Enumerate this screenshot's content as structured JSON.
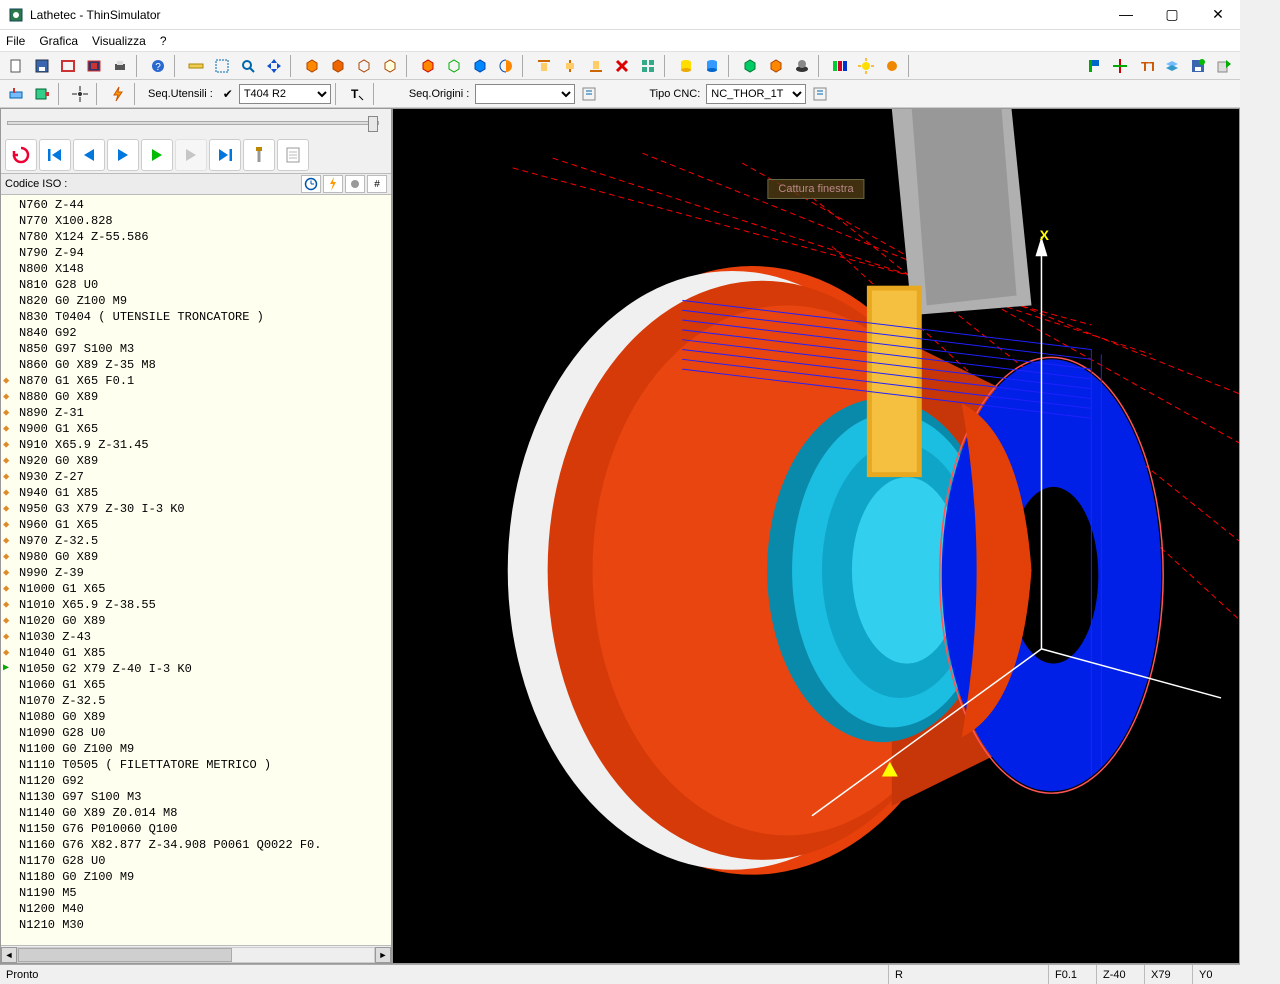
{
  "window": {
    "title": "Lathetec - ThinSimulator"
  },
  "menu": {
    "file": "File",
    "grafica": "Grafica",
    "visualizza": "Visualizza",
    "help": "?"
  },
  "toolbar2": {
    "seq_utensili": "Seq.Utensili :",
    "tool_value": "T404 R2",
    "seq_origini": "Seq.Origini :",
    "origin_value": "",
    "tipo_cnc": "Tipo CNC:",
    "cnc_value": "NC_THOR_1T"
  },
  "code_panel": {
    "label": "Codice ISO :"
  },
  "code_lines": [
    {
      "t": "N760 Z-44",
      "g": false
    },
    {
      "t": "N770 X100.828",
      "g": false
    },
    {
      "t": "N780 X124 Z-55.586",
      "g": false
    },
    {
      "t": "N790 Z-94",
      "g": false
    },
    {
      "t": "N800 X148",
      "g": false
    },
    {
      "t": "N810 G28 U0",
      "g": false
    },
    {
      "t": "N820 G0 Z100 M9",
      "g": false
    },
    {
      "t": "N830 T0404 ( UTENSILE TRONCATORE )",
      "g": false
    },
    {
      "t": "N840 G92",
      "g": false
    },
    {
      "t": "N850 G97 S100 M3",
      "g": false
    },
    {
      "t": "N860 G0 X89 Z-35 M8",
      "g": false
    },
    {
      "t": "N870 G1 X65 F0.1",
      "g": true
    },
    {
      "t": "N880 G0 X89",
      "g": true
    },
    {
      "t": "N890 Z-31",
      "g": true
    },
    {
      "t": "N900 G1 X65",
      "g": true
    },
    {
      "t": "N910 X65.9 Z-31.45",
      "g": true
    },
    {
      "t": "N920 G0 X89",
      "g": true
    },
    {
      "t": "N930 Z-27",
      "g": true
    },
    {
      "t": "N940 G1 X85",
      "g": true
    },
    {
      "t": "N950 G3 X79 Z-30 I-3 K0",
      "g": true
    },
    {
      "t": "N960 G1 X65",
      "g": true
    },
    {
      "t": "N970 Z-32.5",
      "g": true
    },
    {
      "t": "N980 G0 X89",
      "g": true
    },
    {
      "t": "N990 Z-39",
      "g": true
    },
    {
      "t": "N1000 G1 X65",
      "g": true
    },
    {
      "t": "N1010 X65.9 Z-38.55",
      "g": true
    },
    {
      "t": "N1020 G0 X89",
      "g": true
    },
    {
      "t": "N1030 Z-43",
      "g": true
    },
    {
      "t": "N1040 G1 X85",
      "g": true
    },
    {
      "t": "N1050 G2 X79 Z-40 I-3 K0",
      "g": true,
      "cur": true
    },
    {
      "t": "N1060 G1 X65",
      "g": false
    },
    {
      "t": "N1070 Z-32.5",
      "g": false
    },
    {
      "t": "N1080 G0 X89",
      "g": false
    },
    {
      "t": "N1090 G28 U0",
      "g": false
    },
    {
      "t": "N1100 G0 Z100 M9",
      "g": false
    },
    {
      "t": "N1110 T0505 ( FILETTATORE METRICO )",
      "g": false
    },
    {
      "t": "N1120 G92",
      "g": false
    },
    {
      "t": "N1130 G97 S100 M3",
      "g": false
    },
    {
      "t": "N1140 G0 X89 Z0.014 M8",
      "g": false
    },
    {
      "t": "N1150 G76 P010060 Q100",
      "g": false
    },
    {
      "t": "N1160 G76 X82.877 Z-34.908 P0061 Q0022 F0.",
      "g": false
    },
    {
      "t": "N1170 G28 U0",
      "g": false
    },
    {
      "t": "N1180 G0 Z100 M9",
      "g": false
    },
    {
      "t": "N1190 M5",
      "g": false
    },
    {
      "t": "N1200 M40",
      "g": false
    },
    {
      "t": "N1210 M30",
      "g": false
    }
  ],
  "viewport": {
    "axis_x": "X",
    "overlay_button": "Cattura finestra"
  },
  "status": {
    "ready": "Pronto",
    "r": "R",
    "f": "F0.1",
    "z": "Z-40",
    "x": "X79",
    "y": "Y0"
  }
}
